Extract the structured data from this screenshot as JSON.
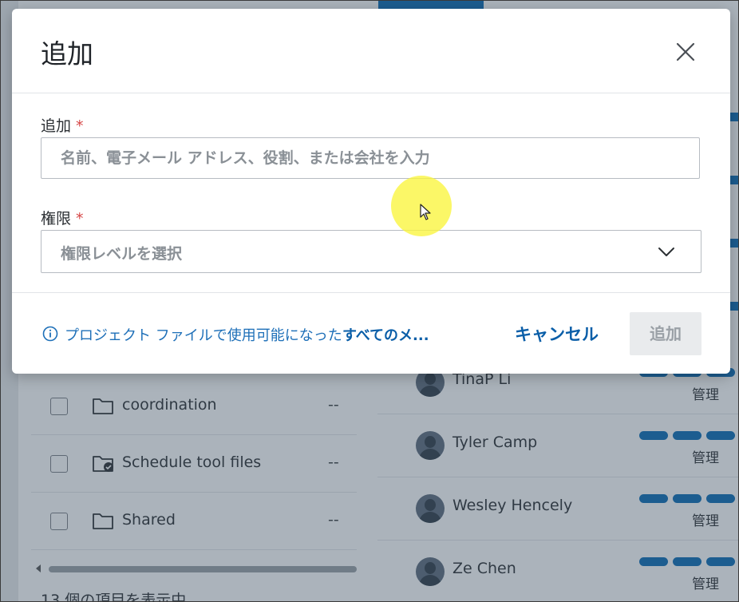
{
  "background": {
    "files": [
      {
        "name": "coordination",
        "modified": "--",
        "icon": "folder-icon"
      },
      {
        "name": "Schedule tool files",
        "modified": "--",
        "icon": "shared-folder-icon"
      },
      {
        "name": "Shared",
        "modified": "--",
        "icon": "folder-icon"
      }
    ],
    "count_text": "13 個の項目を表示中",
    "members": [
      {
        "name": "TinaP Li",
        "role": "管理"
      },
      {
        "name": "Tyler Camp",
        "role": "管理"
      },
      {
        "name": "Wesley Hencely",
        "role": "管理"
      },
      {
        "name": "Ze Chen",
        "role": "管理"
      }
    ]
  },
  "dialog": {
    "title": "追加",
    "close_icon": "close-icon",
    "add_field": {
      "label": "追加",
      "required_mark": "*",
      "value": "",
      "placeholder": "名前、電子メール アドレス、役割、または会社を入力"
    },
    "permission_field": {
      "label": "権限",
      "required_mark": "*",
      "placeholder": "権限レベルを選択",
      "icon": "chevron-down-icon"
    },
    "info": {
      "icon": "info-icon",
      "text": "プロジェクト ファイルで使用可能になった",
      "link": "すべてのメ..."
    },
    "cancel_label": "キャンセル",
    "submit_label": "追加"
  },
  "colors": {
    "accent": "#0a6cb6",
    "link": "#0a5ea8",
    "required": "#d64545",
    "overlay": "#38495c",
    "disabled_bg": "#e9ebed",
    "cursor_highlight": "#faf53c"
  }
}
